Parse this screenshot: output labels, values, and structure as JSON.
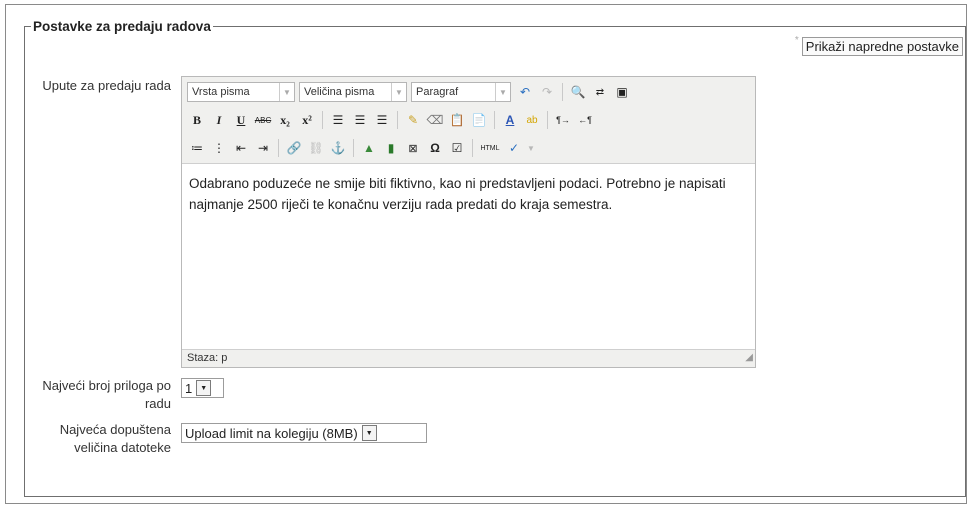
{
  "section_title": "Postavke za predaju radova",
  "advanced_link": "Prikaži napredne postavke",
  "fields": {
    "instructions_label": "Upute za predaju rada",
    "max_files_label": "Najveći broj priloga po radu",
    "max_files_value": "1",
    "max_size_label": "Najveća dopuštena veličina datoteke",
    "max_size_value": "Upload limit na kolegiju (8MB)"
  },
  "editor": {
    "font_family": "Vrsta pisma",
    "font_size": "Veličina pisma",
    "format": "Paragraf",
    "content": "Odabrano poduzeće ne smije biti fiktivno, kao ni predstavljeni podaci. Potrebno je napisati najmanje 2500 riječi te konačnu verziju rada predati do kraja semestra.",
    "path": "Staza: p",
    "buttons": {
      "bold": "B",
      "italic": "I",
      "underline": "U",
      "strike": "ABC",
      "subscript": "x₂",
      "superscript": "x²",
      "html": "HTML"
    }
  }
}
